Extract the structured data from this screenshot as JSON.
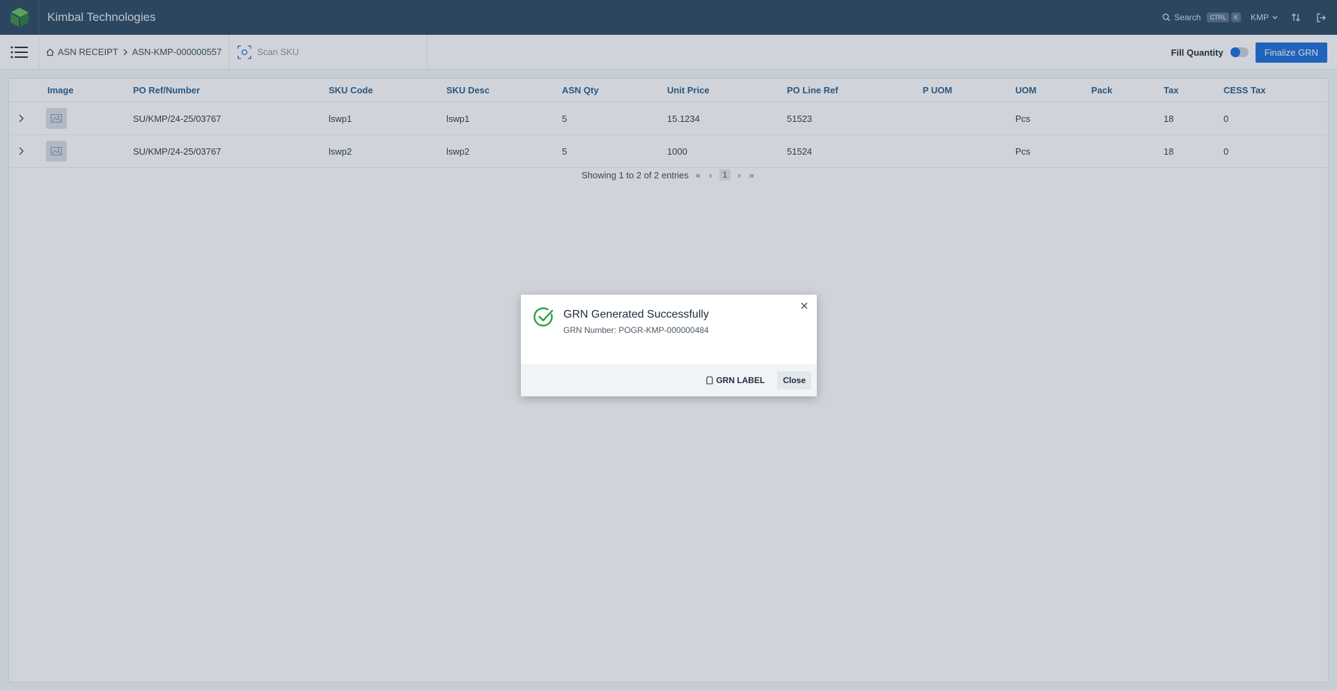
{
  "header": {
    "brand": "Kimbal Technologies",
    "search_label": "Search",
    "kbd_ctrl": "CTRL",
    "kbd_k": "K",
    "org": "KMP"
  },
  "toolbar": {
    "crumb_root": "ASN RECEIPT",
    "crumb_current": "ASN-KMP-000000557",
    "scan_label": "Scan SKU",
    "fill_quantity_label": "Fill Quantity",
    "fill_quantity_on": false,
    "finalize_label": "Finalize GRN"
  },
  "table": {
    "columns": [
      "Image",
      "PO Ref/Number",
      "SKU Code",
      "SKU Desc",
      "ASN Qty",
      "Unit Price",
      "PO Line Ref",
      "P UOM",
      "UOM",
      "Pack",
      "Tax",
      "CESS Tax"
    ],
    "rows": [
      {
        "po_ref": "SU/KMP/24-25/03767",
        "sku_code": "lswp1",
        "sku_desc": "lswp1",
        "asn_qty": "5",
        "unit_price": "15.1234",
        "po_line_ref": "51523",
        "p_uom": "",
        "uom": "Pcs",
        "pack": "",
        "tax": "18",
        "cess_tax": "0"
      },
      {
        "po_ref": "SU/KMP/24-25/03767",
        "sku_code": "lswp2",
        "sku_desc": "lswp2",
        "asn_qty": "5",
        "unit_price": "1000",
        "po_line_ref": "51524",
        "p_uom": "",
        "uom": "Pcs",
        "pack": "",
        "tax": "18",
        "cess_tax": "0"
      }
    ],
    "pager": {
      "summary": "Showing 1 to 2 of 2 entries",
      "first": "«",
      "prev": "‹",
      "page": "1",
      "next": "›",
      "last": "»"
    }
  },
  "dialog": {
    "title": "GRN Generated Successfully",
    "subtitle": "GRN Number: POGR-KMP-000000484",
    "label_button": "GRN LABEL",
    "close_button": "Close",
    "success_color": "#2e9e3e"
  },
  "colors": {
    "header_bg": "#2e4a63",
    "accent": "#1e6fd9",
    "column_header": "#2e5d8a"
  }
}
